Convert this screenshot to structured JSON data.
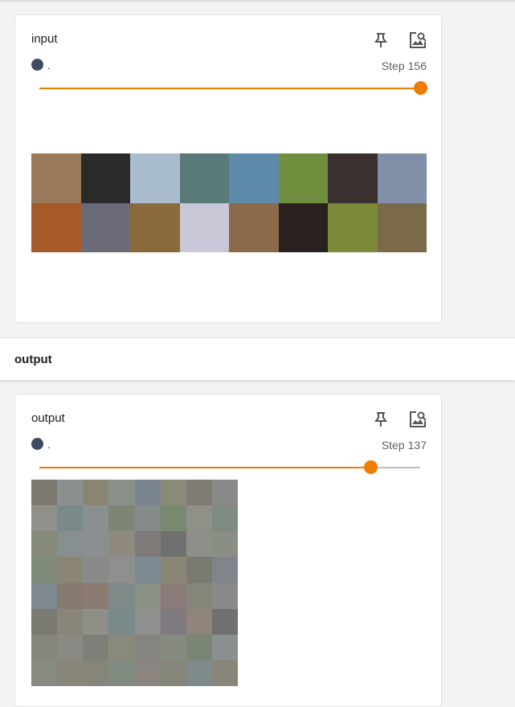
{
  "input_card": {
    "title": "input",
    "run_label": ".",
    "step_label": "Step",
    "step_value": "156",
    "slider_fraction": 1.0,
    "icons": [
      "pin-icon",
      "image-search-icon"
    ],
    "image_colors": [
      "#9a7a5a",
      "#2a2a2a",
      "#a9bccb",
      "#5a7a7a",
      "#5d8aa8",
      "#6f8f3f",
      "#3a3030",
      "#8090a8",
      "#a65a2a",
      "#6a6a78",
      "#8a6a3a",
      "#c8c8d8",
      "#8a6a4a",
      "#2a2020",
      "#7a8a3a",
      "#7a6a4a"
    ]
  },
  "section": {
    "title": "output"
  },
  "output_card": {
    "title": "output",
    "run_label": ".",
    "step_label": "Step",
    "step_value": "137",
    "slider_fraction": 0.87,
    "icons": [
      "pin-icon",
      "image-search-icon"
    ],
    "image_colors": [
      "#7f7a70",
      "#8a8f8f",
      "#8a8570",
      "#889088",
      "#7a8590",
      "#8a8a78",
      "#7f7a74",
      "#8a8a8a",
      "#90908a",
      "#7a8a8a",
      "#8a8f90",
      "#7f8575",
      "#858a8a",
      "#7a8a70",
      "#908f88",
      "#7f8a80",
      "#858a7a",
      "#888f90",
      "#8a908f",
      "#8f8a80",
      "#7f7a7a",
      "#6f7070",
      "#8f8f8a",
      "#8a8f85",
      "#7f8a78",
      "#8a8575",
      "#8a8a88",
      "#8f8f8f",
      "#7a8a90",
      "#8a8575",
      "#7a7a70",
      "#7f858a",
      "#7f8a90",
      "#857a70",
      "#8a7a70",
      "#7f8a88",
      "#8a9085",
      "#8a7a7a",
      "#85857a",
      "#8a8a8a",
      "#7a7a70",
      "#8a857a",
      "#8f8f8a",
      "#7a8a8a",
      "#8f8f8f",
      "#7f7a7f",
      "#8f857a",
      "#707070",
      "#85857a",
      "#8a8a85",
      "#7f7f7a",
      "#8a8a7a",
      "#858580",
      "#858a80",
      "#7a8575",
      "#8a8f90",
      "#888a80",
      "#8a857a",
      "#85857a",
      "#7f8a80",
      "#8a8580",
      "#85857a",
      "#7f8a8a",
      "#8a857a"
    ]
  }
}
